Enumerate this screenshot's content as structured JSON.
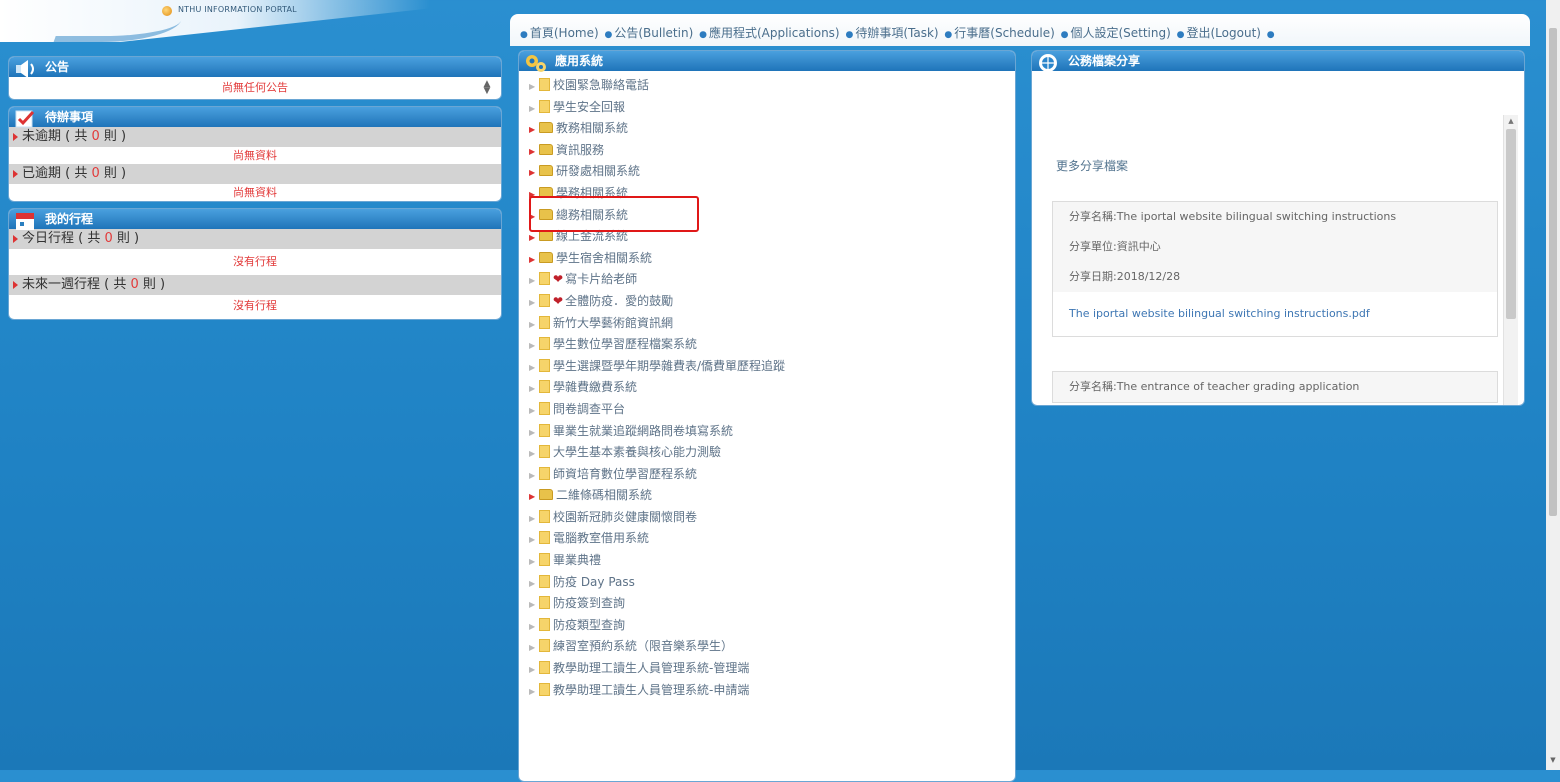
{
  "header": {
    "logo_text": "NTHU INFORMATION PORTAL",
    "nav": [
      {
        "label": "首頁(Home)"
      },
      {
        "label": "公告(Bulletin)"
      },
      {
        "label": "應用程式(Applications)"
      },
      {
        "label": "待辦事項(Task)"
      },
      {
        "label": "行事曆(Schedule)"
      },
      {
        "label": "個人設定(Setting)"
      },
      {
        "label": "登出(Logout)"
      }
    ]
  },
  "announcements": {
    "title": "公告",
    "empty_text": "尚無任何公告"
  },
  "todo": {
    "title": "待辦事項",
    "rows": [
      {
        "prefix": "未逾期 ( 共 ",
        "count": "0",
        "suffix": " 則 )",
        "empty_text": "尚無資料"
      },
      {
        "prefix": "已逾期 ( 共 ",
        "count": "0",
        "suffix": " 則 )",
        "empty_text": "尚無資料"
      }
    ]
  },
  "schedule": {
    "title": "我的行程",
    "rows": [
      {
        "prefix": "今日行程 ( 共 ",
        "count": "0",
        "suffix": " 則 )",
        "empty_text": "沒有行程"
      },
      {
        "prefix": "未來一週行程 ( 共 ",
        "count": "0",
        "suffix": " 則 )",
        "empty_text": "沒有行程"
      }
    ]
  },
  "applications": {
    "title": "應用系統",
    "items": [
      {
        "label": "校園緊急聯絡電話",
        "icon": "file-icon"
      },
      {
        "label": "學生安全回報",
        "icon": "file-icon"
      },
      {
        "label": "教務相關系統",
        "icon": "folder-icon"
      },
      {
        "label": "資訊服務",
        "icon": "folder-icon"
      },
      {
        "label": "研發處相關系統",
        "icon": "folder-icon"
      },
      {
        "label": "學務相關系統",
        "icon": "folder-icon"
      },
      {
        "label": "總務相關系統",
        "icon": "folder-icon"
      },
      {
        "label": "線上金流系統",
        "icon": "folder-icon"
      },
      {
        "label": "學生宿舍相關系統",
        "icon": "folder-icon"
      },
      {
        "label": "寫卡片給老師",
        "icon": "heart-icon"
      },
      {
        "label": "全體防疫．愛的鼓勵",
        "icon": "heart-icon"
      },
      {
        "label": "新竹大學藝術館資訊網",
        "icon": "file-icon"
      },
      {
        "label": "學生數位學習歷程檔案系統",
        "icon": "file-icon"
      },
      {
        "label": "學生選課暨學年期學雜費表/僑費單歷程追蹤",
        "icon": "file-icon"
      },
      {
        "label": "學雜費繳費系統",
        "icon": "file-icon"
      },
      {
        "label": "問卷調查平台",
        "icon": "file-icon"
      },
      {
        "label": "畢業生就業追蹤網路問卷填寫系統",
        "icon": "file-icon"
      },
      {
        "label": "大學生基本素養與核心能力測驗",
        "icon": "file-icon"
      },
      {
        "label": "師資培育數位學習歷程系統",
        "icon": "file-icon"
      },
      {
        "label": "二維條碼相關系統",
        "icon": "folder-icon"
      },
      {
        "label": "校園新冠肺炎健康關懷問卷",
        "icon": "file-icon"
      },
      {
        "label": "電腦教室借用系統",
        "icon": "file-icon"
      },
      {
        "label": "畢業典禮",
        "icon": "file-icon"
      },
      {
        "label": "防疫 Day Pass",
        "icon": "file-icon"
      },
      {
        "label": "防疫簽到查詢",
        "icon": "file-icon"
      },
      {
        "label": "防疫類型查詢",
        "icon": "file-icon"
      },
      {
        "label": "練習室預約系統（限音樂系學生）",
        "icon": "file-icon"
      },
      {
        "label": "教學助理工讀生人員管理系統-管理端",
        "icon": "file-icon"
      },
      {
        "label": "教學助理工讀生人員管理系統-申請端",
        "icon": "file-icon"
      }
    ]
  },
  "file_share": {
    "title": "公務檔案分享",
    "more_label": "更多分享檔案",
    "cards": [
      {
        "name": "分享名稱:The iportal website bilingual switching instructions",
        "unit": "分享單位:資訊中心",
        "date": "分享日期:2018/12/28",
        "file": "The iportal website bilingual switching instructions.pdf"
      },
      {
        "name": "分享名稱:The entrance of teacher grading application"
      }
    ]
  },
  "colors": {
    "page_bg": "#1f82c4",
    "panel_header": "#1f74b9",
    "alert_red": "#e23a3a",
    "highlight_border": "#e01818"
  }
}
